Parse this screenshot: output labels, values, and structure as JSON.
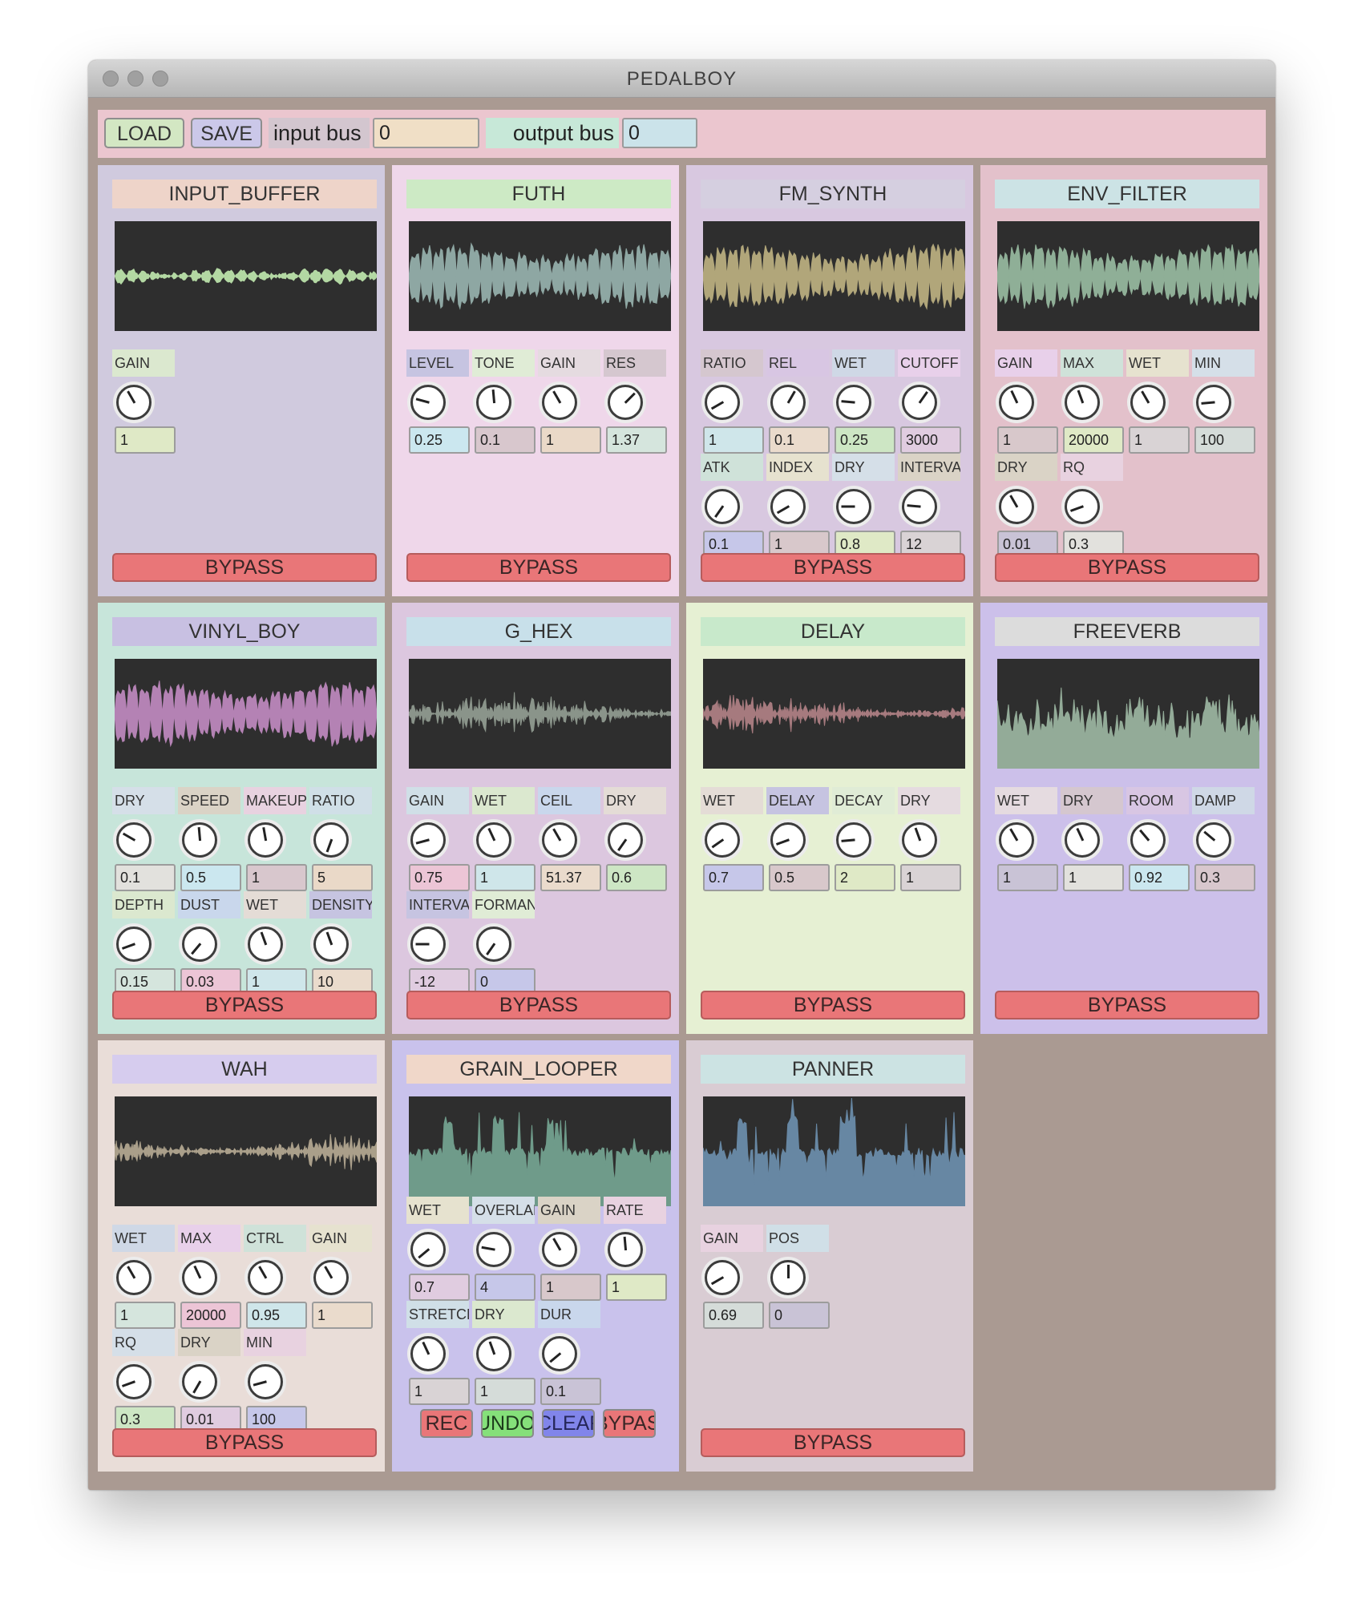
{
  "window": {
    "title": "PEDALBOY"
  },
  "toolbar": {
    "load_label": "LOAD",
    "save_label": "SAVE",
    "input_bus_label": "input bus",
    "input_bus_value": "0",
    "output_bus_label": "output bus",
    "output_bus_value": "0"
  },
  "bypass_label": "BYPASS",
  "modules": [
    {
      "name": "INPUT_BUFFER",
      "params": [
        {
          "label": "GAIN",
          "value": "1"
        }
      ]
    },
    {
      "name": "FUTH",
      "params": [
        {
          "label": "LEVEL",
          "value": "0.25"
        },
        {
          "label": "TONE",
          "value": "0.1"
        },
        {
          "label": "GAIN",
          "value": "1"
        },
        {
          "label": "RES",
          "value": "1.37"
        }
      ]
    },
    {
      "name": "FM_SYNTH",
      "params": [
        {
          "label": "RATIO",
          "value": "1"
        },
        {
          "label": "REL",
          "value": "0.1"
        },
        {
          "label": "WET",
          "value": "0.25"
        },
        {
          "label": "CUTOFF",
          "value": "3000"
        },
        {
          "label": "ATK",
          "value": "0.1"
        },
        {
          "label": "INDEX",
          "value": "1"
        },
        {
          "label": "DRY",
          "value": "0.8"
        },
        {
          "label": "INTERVAL",
          "value": "12"
        }
      ]
    },
    {
      "name": "ENV_FILTER",
      "params": [
        {
          "label": "GAIN",
          "value": "1"
        },
        {
          "label": "MAX",
          "value": "20000"
        },
        {
          "label": "WET",
          "value": "1"
        },
        {
          "label": "MIN",
          "value": "100"
        },
        {
          "label": "DRY",
          "value": "0.01"
        },
        {
          "label": "RQ",
          "value": "0.3"
        }
      ]
    },
    {
      "name": "VINYL_BOY",
      "params": [
        {
          "label": "DRY",
          "value": "0.1"
        },
        {
          "label": "SPEED",
          "value": "0.5"
        },
        {
          "label": "MAKEUP",
          "value": "1"
        },
        {
          "label": "RATIO",
          "value": "5"
        },
        {
          "label": "DEPTH",
          "value": "0.15"
        },
        {
          "label": "DUST",
          "value": "0.03"
        },
        {
          "label": "WET",
          "value": "1"
        },
        {
          "label": "DENSITY",
          "value": "10"
        }
      ]
    },
    {
      "name": "G_HEX",
      "params": [
        {
          "label": "GAIN",
          "value": "0.75"
        },
        {
          "label": "WET",
          "value": "1"
        },
        {
          "label": "CEIL",
          "value": "51.37"
        },
        {
          "label": "DRY",
          "value": "0.6"
        },
        {
          "label": "INTERVAL",
          "value": "-12"
        },
        {
          "label": "FORMANT",
          "value": "0"
        }
      ]
    },
    {
      "name": "DELAY",
      "params": [
        {
          "label": "WET",
          "value": "0.7"
        },
        {
          "label": "DELAY",
          "value": "0.5"
        },
        {
          "label": "DECAY",
          "value": "2"
        },
        {
          "label": "DRY",
          "value": "1"
        }
      ]
    },
    {
      "name": "FREEVERB",
      "params": [
        {
          "label": "WET",
          "value": "1"
        },
        {
          "label": "DRY",
          "value": "1"
        },
        {
          "label": "ROOM",
          "value": "0.92"
        },
        {
          "label": "DAMP",
          "value": "0.3"
        }
      ]
    },
    {
      "name": "WAH",
      "params": [
        {
          "label": "WET",
          "value": "1"
        },
        {
          "label": "MAX",
          "value": "20000"
        },
        {
          "label": "CTRL",
          "value": "0.95"
        },
        {
          "label": "GAIN",
          "value": "1"
        },
        {
          "label": "RQ",
          "value": "0.3"
        },
        {
          "label": "DRY",
          "value": "0.01"
        },
        {
          "label": "MIN",
          "value": "100"
        }
      ]
    },
    {
      "name": "GRAIN_LOOPER",
      "params": [
        {
          "label": "WET",
          "value": "0.7"
        },
        {
          "label": "OVERLAP",
          "value": "4"
        },
        {
          "label": "GAIN",
          "value": "1"
        },
        {
          "label": "RATE",
          "value": "1"
        },
        {
          "label": "STRETCH",
          "value": "1"
        },
        {
          "label": "DRY",
          "value": "1"
        },
        {
          "label": "DUR",
          "value": "0.1"
        }
      ],
      "buttons": [
        "REC",
        "UNDO",
        "CLEAR",
        "BYPASS"
      ]
    },
    {
      "name": "PANNER",
      "params": [
        {
          "label": "GAIN",
          "value": "0.69"
        },
        {
          "label": "POS",
          "value": "0"
        }
      ]
    }
  ],
  "colors": {
    "window_bg": "#aa9a92",
    "toolbar_bg": "#ebc6cf",
    "bypass": "#e97678",
    "scope_bg": "#2e2e2e"
  }
}
